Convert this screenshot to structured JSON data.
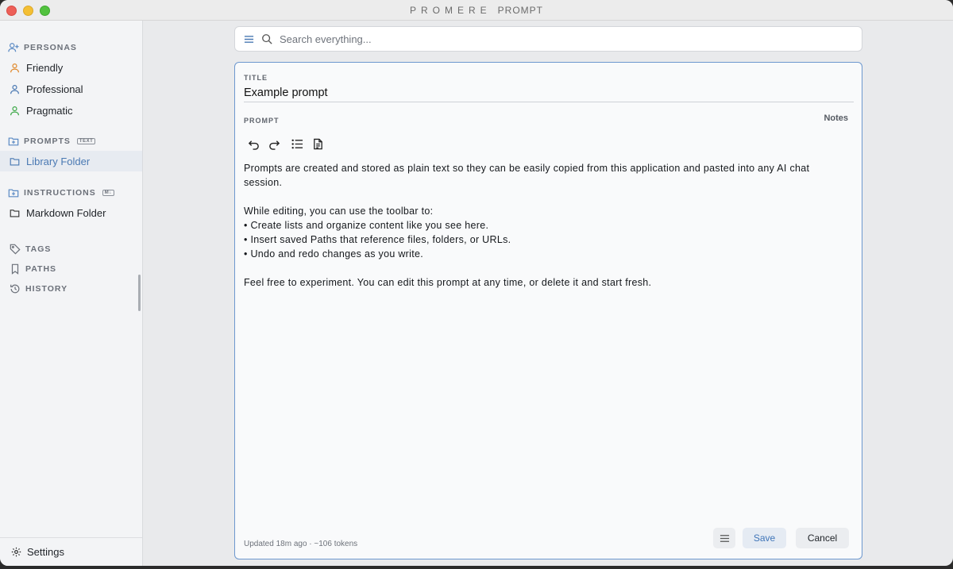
{
  "app": {
    "brand": "PROMERE",
    "subtitle": "PROMPT"
  },
  "sidebar": {
    "personas": {
      "heading": "PERSONAS",
      "items": [
        {
          "label": "Friendly",
          "icon": "person-icon",
          "color": "#e08a2e"
        },
        {
          "label": "Professional",
          "icon": "person-icon",
          "color": "#4a79b3"
        },
        {
          "label": "Pragmatic",
          "icon": "person-icon",
          "color": "#3fa94a"
        }
      ]
    },
    "prompts": {
      "heading": "PROMPTS",
      "badge": "TEXT",
      "items": [
        {
          "label": "Library Folder",
          "icon": "folder-icon",
          "active": true
        }
      ]
    },
    "instructions": {
      "heading": "INSTRUCTIONS",
      "badge": "M↓",
      "items": [
        {
          "label": "Markdown Folder",
          "icon": "folder-icon"
        }
      ]
    },
    "tags": {
      "heading": "TAGS"
    },
    "paths": {
      "heading": "PATHS"
    },
    "history": {
      "heading": "HISTORY"
    },
    "settings_label": "Settings"
  },
  "search": {
    "placeholder": "Search everything..."
  },
  "editor": {
    "title_label": "TITLE",
    "title_value": "Example prompt",
    "prompt_label": "PROMPT",
    "notes_label": "Notes",
    "body_lines": [
      "Prompts are created and stored as plain text so they can be easily copied from this application and pasted into any AI chat session.",
      "",
      "While editing, you can use the toolbar to:",
      "• Create lists and organize content like you see here.",
      "• Insert saved Paths that reference files, folders, or URLs.",
      "• Undo and redo changes as you write.",
      "",
      "Feel free to experiment. You can edit this prompt at any time, or delete it and start fresh."
    ],
    "footer_meta": "Updated 18m ago · ~106 tokens",
    "save_label": "Save",
    "cancel_label": "Cancel"
  },
  "colors": {
    "accent": "#4a79b3",
    "editor_border": "#6d98cf"
  }
}
